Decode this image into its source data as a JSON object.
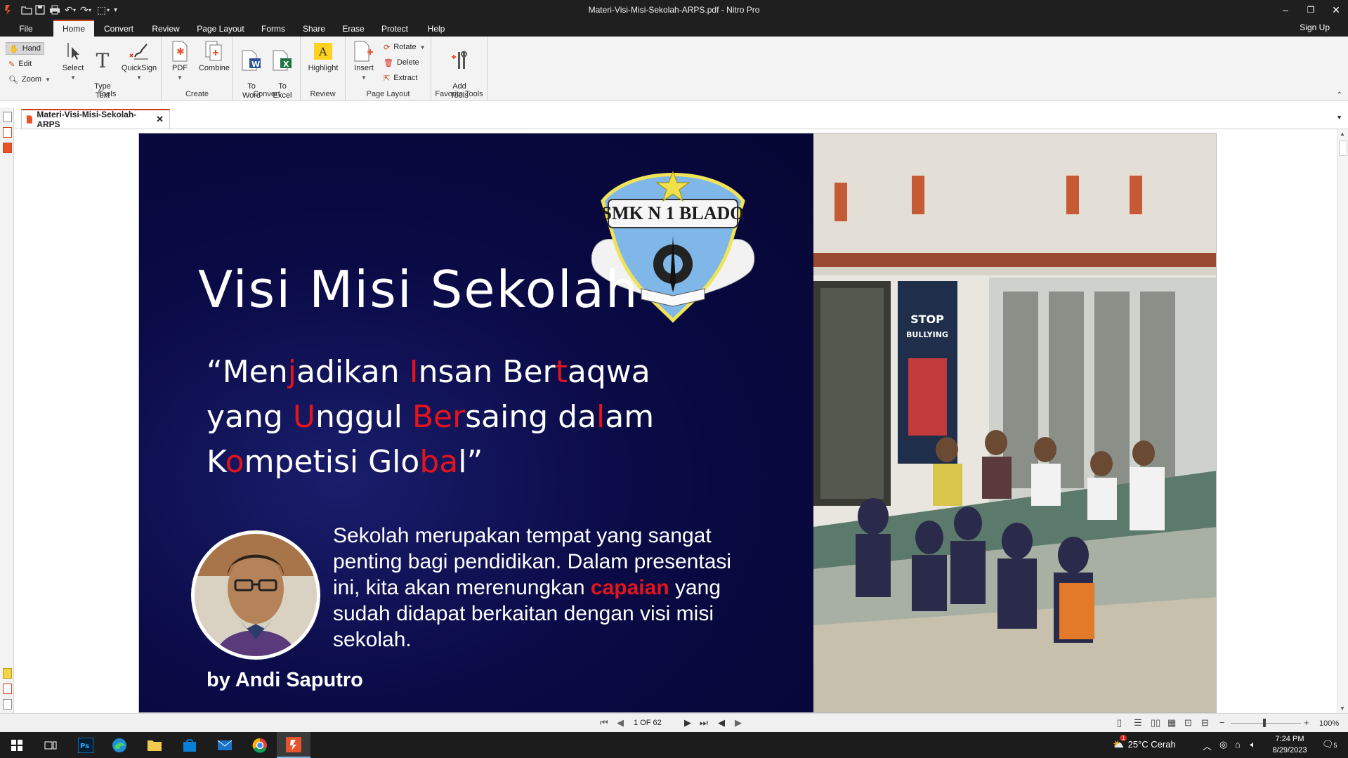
{
  "window": {
    "title": "Materi-Visi-Misi-Sekolah-ARPS.pdf - Nitro Pro",
    "minimize_icon": "–",
    "restore_icon": "❐",
    "close_icon": "✕"
  },
  "menu": {
    "tabs": [
      "File",
      "Home",
      "Convert",
      "Review",
      "Page Layout",
      "Forms",
      "Share",
      "Erase",
      "Protect",
      "Help"
    ],
    "active": "Home",
    "sign_up": "Sign Up"
  },
  "ribbon": {
    "hand": "Hand",
    "edit": "Edit",
    "zoom": "Zoom",
    "tools_group": {
      "label": "Tools",
      "select": "Select",
      "type_text": "Type\nText",
      "quicksign": "QuickSign"
    },
    "create_group": {
      "label": "Create",
      "pdf": "PDF",
      "combine": "Combine"
    },
    "convert_group": {
      "label": "Convert",
      "to_word": "To\nWord",
      "to_excel": "To\nExcel"
    },
    "review_group": {
      "label": "Review",
      "highlight": "Highlight"
    },
    "page_layout_group": {
      "label": "Page Layout",
      "insert": "Insert",
      "rotate": "Rotate",
      "delete": "Delete",
      "extract": "Extract"
    },
    "favorite_group": {
      "label": "Favorite Tools",
      "add_tools": "Add\nTools"
    }
  },
  "document_tab": {
    "name": "Materi-Visi-Misi-Sekolah-ARPS",
    "close": "✕"
  },
  "slide": {
    "logo_text": "SMK N 1 BLADO",
    "title": "Visi Misi Sekolah",
    "quote": [
      [
        [
          "“Men",
          false
        ],
        [
          "j",
          true
        ],
        [
          "adikan ",
          false
        ],
        [
          "I",
          true
        ],
        [
          "nsan Ber",
          false
        ],
        [
          "t",
          true
        ],
        [
          "aqwa",
          false
        ]
      ],
      [
        [
          "yang ",
          false
        ],
        [
          "U",
          true
        ],
        [
          "nggul ",
          false
        ],
        [
          "Ber",
          true
        ],
        [
          "saing da",
          false
        ],
        [
          "l",
          true
        ],
        [
          "am",
          false
        ]
      ],
      [
        [
          "K",
          false
        ],
        [
          "o",
          true
        ],
        [
          "m",
          false
        ],
        [
          "petisi Glo",
          false
        ],
        [
          "ba",
          true
        ],
        [
          "l”",
          false
        ]
      ]
    ],
    "description_parts": [
      [
        "Sekolah merupakan tempat yang sangat penting bagi pendidikan. Dalam presentasi ini, kita akan merenungkan ",
        false
      ],
      [
        "capaian",
        true
      ],
      [
        " yang sudah didapat berkaitan dengan visi misi sekolah.",
        false
      ]
    ],
    "author": "by Andi Saputro",
    "poster_text": "STOP BULLYING"
  },
  "page_nav": {
    "indicator": "1 OF 62",
    "zoom": "100%"
  },
  "taskbar": {
    "weather": "25°C  Cerah",
    "time": "7:24 PM",
    "date": "8/29/2023",
    "notif_count": "5",
    "weather_badge": "1"
  }
}
